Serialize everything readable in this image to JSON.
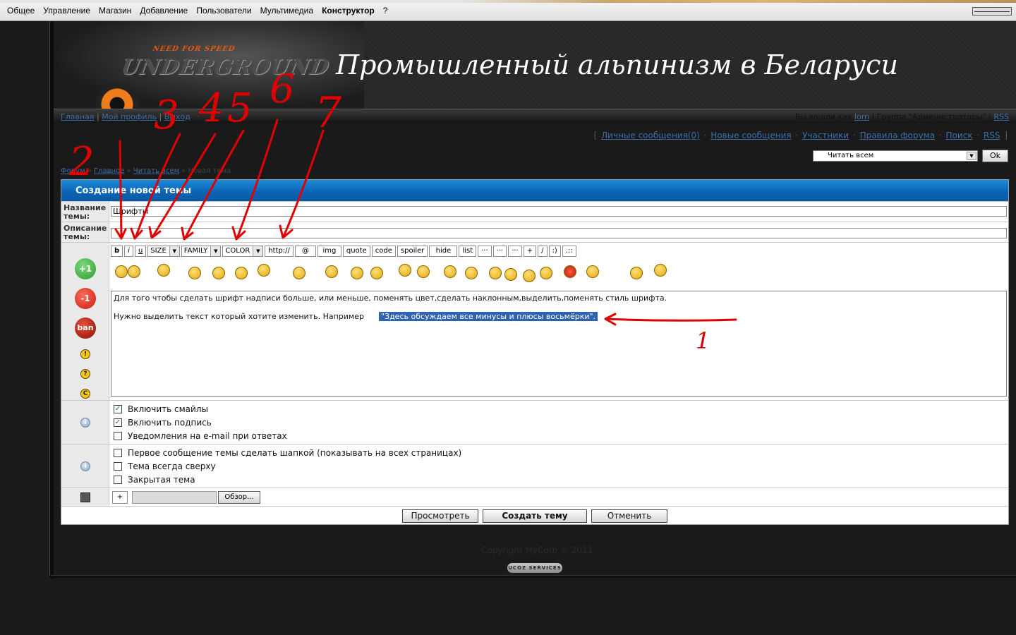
{
  "adminbar": {
    "menu": [
      "Общее",
      "Управление",
      "Магазин",
      "Добавление",
      "Пользователи",
      "Мультимедиа",
      "Конструктор",
      "?"
    ],
    "active": "Конструктор"
  },
  "header": {
    "site_title": "Промышленный альпинизм в Беларуси",
    "logo_text": "UNDERGROUND",
    "logo_small": "NEED FOR SPEED"
  },
  "navbar": {
    "links": [
      "Главная",
      "Мой профиль",
      "Выход"
    ],
    "user_prefix": "Вы вошли как",
    "user_name": "lorn",
    "group_text": "Группа \"Администраторы\"",
    "rss": "RSS"
  },
  "userbar": {
    "links": [
      "Личные сообщения(0)",
      "Новые сообщения",
      "Участники",
      "Правила форума",
      "Поиск",
      "RSS"
    ]
  },
  "read_select": {
    "value": "Читать всем",
    "ok_label": "Ok"
  },
  "breadcrumb": {
    "items": [
      "Форум",
      "Главное",
      "Читать всем"
    ],
    "current": "Новая тема"
  },
  "form": {
    "title": "Создание новой темы",
    "name_label": "Название темы:",
    "name_value": "Шрифты",
    "desc_label": "Описание темы:",
    "desc_value": "",
    "toolbar": {
      "b": "b",
      "i": "i",
      "u": "u",
      "size": "SIZE",
      "family": "FAMILY",
      "color": "COLOR",
      "buttons": [
        "http://",
        "@",
        "img",
        "quote",
        "code",
        "spoiler",
        "hide",
        "list",
        "···",
        "···",
        "···",
        "+",
        "/",
        ":)",
        ".::"
      ]
    },
    "sidebar": {
      "plus": "+1",
      "minus": "-1",
      "ban": "ban",
      "i1": "!",
      "i2": "?",
      "i3": "C"
    },
    "text_line1": "Для того чтобы сделать шрифт надписи больше, или меньше, поменять цвет,сделать наклонным,выделить,поменять стиль шрифта.",
    "text_line2": "Нужно выделить текст который хотите изменить. Например",
    "text_highlight": "\"Здесь обсуждаем все минусы и плюсы восьмёрки\".",
    "options1": [
      {
        "label": "Включить смайлы",
        "checked": true
      },
      {
        "label": "Включить подпись",
        "checked": true
      },
      {
        "label": "Уведомления на e-mail при ответах",
        "checked": false
      }
    ],
    "options2": [
      {
        "label": "Первое сообщение темы сделать шапкой (показывать на всех страницах)",
        "checked": false
      },
      {
        "label": "Тема всегда сверху",
        "checked": false
      },
      {
        "label": "Закрытая тема",
        "checked": false
      }
    ],
    "attach_plus": "+",
    "browse_label": "Обзор...",
    "preview_label": "Просмотреть",
    "submit_label": "Создать тему",
    "cancel_label": "Отменить"
  },
  "footer": {
    "copyright": "Copyright MyCorp © 2011",
    "badge": "UCOZ SERVICES"
  },
  "annotations": [
    "1",
    "2",
    "3",
    "4",
    "5",
    "6",
    "7"
  ],
  "colors": {
    "accent": "#0b63b3",
    "annotation": "#e00000",
    "selection": "#3162ad"
  }
}
